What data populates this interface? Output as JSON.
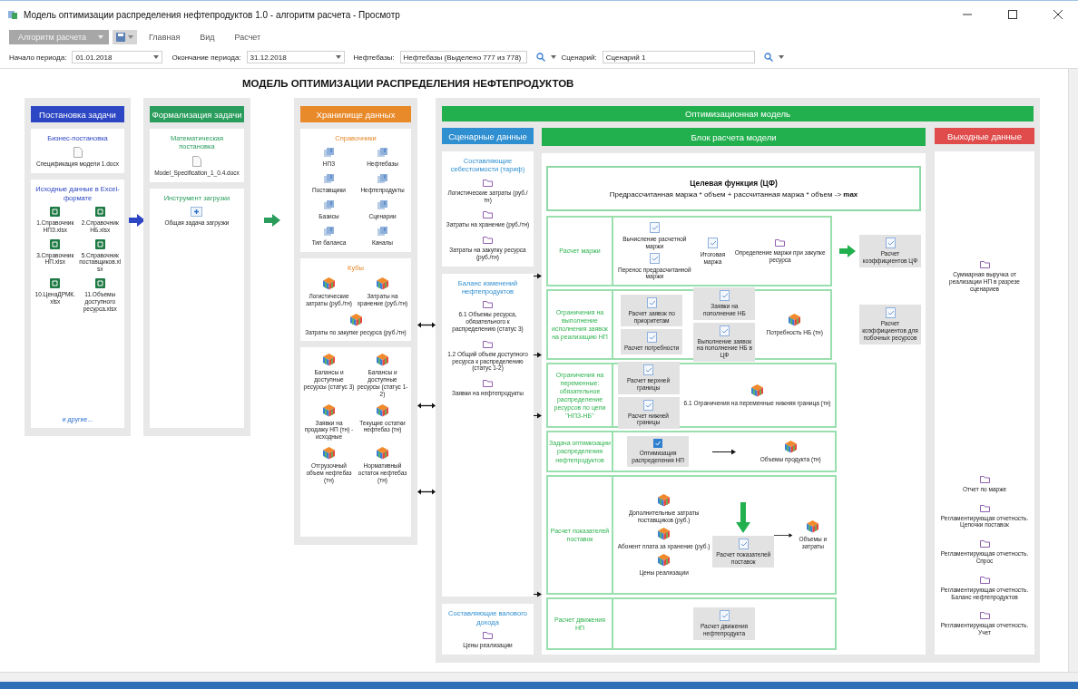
{
  "window": {
    "title": "Модель оптимизации распределения нефтепродуктов 1.0 - алгоритм расчета - Просмотр"
  },
  "ribbon": {
    "menu_button": "Алгоритм расчета",
    "tabs": [
      "Главная",
      "Вид",
      "Расчет"
    ]
  },
  "filters": [
    {
      "label": "Начало периода:",
      "value": "01.01.2018",
      "kind": "date"
    },
    {
      "label": "Окончание периода:",
      "value": "31.12.2018",
      "kind": "date"
    },
    {
      "label": "Нефтебазы:",
      "value": "Нефтебазы (Выделено 777 из 778)",
      "kind": "lookup"
    },
    {
      "label": "Сценарий:",
      "value": "Сценарий 1",
      "kind": "lookup"
    }
  ],
  "diagram": {
    "title": "МОДЕЛЬ ОПТИМИЗАЦИИ РАСПРЕДЕЛЕНИЯ НЕФТЕПРОДУКТОВ",
    "columns": [
      {
        "header": "Постановка задачи",
        "color": "#2d46c3",
        "cards": [
          {
            "title": "Бизнес-постановка",
            "items": [
              {
                "kind": "doc",
                "label": "Спецификация модели 1.docx"
              }
            ]
          },
          {
            "title": "Исходные данные в Excel-формате",
            "link": "и другие...",
            "items": [
              {
                "kind": "excel",
                "label": "1.Справочник НПЗ.xlsx"
              },
              {
                "kind": "excel",
                "label": "2.Справочник НБ.xlsx"
              },
              {
                "kind": "excel",
                "label": "3.Справочник НП.xlsx"
              },
              {
                "kind": "excel",
                "label": "5.Справочник поставщиков.xlsx"
              },
              {
                "kind": "excel",
                "label": "10.ЦенаДРМК.xlsx"
              },
              {
                "kind": "excel",
                "label": "11.Объемы доступного ресурса.xlsx"
              }
            ]
          }
        ]
      },
      {
        "header": "Формализация задачи",
        "color": "#2a9d5c",
        "cards": [
          {
            "title": "Математическая постановка",
            "items": [
              {
                "kind": "doc",
                "label": "Model_Specification_1_0.4.docx"
              }
            ]
          },
          {
            "title": "Инструмент загрузки",
            "items": [
              {
                "kind": "upload",
                "label": "Общая задача загрузки"
              }
            ]
          }
        ]
      },
      {
        "header": "Хранилище данных",
        "color": "#e8892a",
        "cards": [
          {
            "title": "Справочники",
            "items": [
              {
                "kind": "db",
                "label": "НПЗ"
              },
              {
                "kind": "db",
                "label": "Нефтебазы"
              },
              {
                "kind": "db",
                "label": "Поставщики"
              },
              {
                "kind": "db",
                "label": "Нефтепродукты"
              },
              {
                "kind": "db",
                "label": "Базисы"
              },
              {
                "kind": "db",
                "label": "Сценарии"
              },
              {
                "kind": "db",
                "label": "Тип баланса"
              },
              {
                "kind": "db",
                "label": "Каналы"
              }
            ]
          },
          {
            "title": "Кубы",
            "items": [
              {
                "kind": "cube",
                "label": "Логистические затраты (руб./тн)"
              },
              {
                "kind": "cube",
                "label": "Затраты на хранение (руб./тн)"
              },
              {
                "kind": "cube",
                "label": "Затраты по закупке ресурса (руб./тн)"
              }
            ]
          },
          {
            "items": [
              {
                "kind": "cube",
                "label": "Балансы и доступные ресурсы (статус 3)"
              },
              {
                "kind": "cube",
                "label": "Балансы и доступные ресурсы (статус 1-2)"
              },
              {
                "kind": "cube",
                "label": "Заявки на продажу НП (тн) - исходные"
              },
              {
                "kind": "cube",
                "label": "Текущие остатки нефтебаз (тн)"
              },
              {
                "kind": "cube",
                "label": "Отгрузочный объем нефтебаз (тн)"
              },
              {
                "kind": "cube",
                "label": "Нормативный остаток нефтебаз (тн)"
              }
            ]
          }
        ]
      }
    ],
    "model": {
      "header": "Оптимизационная модель",
      "color": "#22b04f",
      "scenario": {
        "header": "Сценарные данные",
        "color": "#2f8fd0",
        "cards": [
          {
            "title": "Составляющие себестоимости (тариф)",
            "items": [
              {
                "kind": "folder",
                "label": "Логистические затраты (руб./тн)"
              },
              {
                "kind": "folder",
                "label": "Затраты на хранение (руб./тн)"
              },
              {
                "kind": "folder",
                "label": "Затраты на закупку ресурса (руб./тн)"
              }
            ]
          },
          {
            "title": "Баланс изменений нефтепродуктов",
            "items": [
              {
                "kind": "folder",
                "label": "6.1 Объемы ресурса, обязательного к распределению (статус 3)"
              },
              {
                "kind": "folder",
                "label": "1.2 Общий объем доступного ресурса к распределению (статус 1-2)"
              },
              {
                "kind": "folder",
                "label": "Заявки на нефтепродукты"
              }
            ]
          },
          {
            "title": "Составляющие валового дохода",
            "items": [
              {
                "kind": "folder",
                "label": "Цены реализации"
              }
            ]
          }
        ]
      },
      "calc": {
        "header": "Блок расчета модели",
        "objective": {
          "title": "Целевая функция (ЦФ)",
          "formula": "Предрассчитанная маржа * объем + рассчитанная маржа * объем -> **max**"
        },
        "rows": [
          {
            "label": "Расчет маржи",
            "groups": [
              {
                "kind": "stack",
                "items": [
                  {
                    "kind": "form",
                    "label": "Вычисление расчетной маржи",
                    "shaded": false
                  },
                  {
                    "kind": "form",
                    "label": "Перенос предрасчитанной маржи",
                    "shaded": false
                  }
                ]
              },
              {
                "kind": "stack",
                "items": [
                  {
                    "kind": "form",
                    "label": "Итоговая маржа",
                    "shaded": false
                  }
                ]
              },
              {
                "kind": "stack",
                "items": [
                  {
                    "kind": "folder",
                    "label": "Определение маржи при закупке ресурса",
                    "shaded": false
                  }
                ]
              }
            ],
            "side": {
              "arrow": true,
              "item": {
                "kind": "form",
                "label": "Расчет коэффициентов ЦФ",
                "shaded": true
              }
            }
          },
          {
            "label": "Ограничения на выполнение исполнения заявок на реализацию НП",
            "groups": [
              {
                "kind": "stack",
                "items": [
                  {
                    "kind": "form",
                    "label": "Расчет заявок по приоритетам",
                    "shaded": true
                  },
                  {
                    "kind": "form",
                    "label": "Расчет потребности",
                    "shaded": true
                  }
                ]
              },
              {
                "kind": "stack",
                "items": [
                  {
                    "kind": "form",
                    "label": "Заявки на пополнение НБ",
                    "shaded": true
                  },
                  {
                    "kind": "form",
                    "label": "Выполнение заявок на пополнение НБ в ЦФ",
                    "shaded": true
                  }
                ]
              },
              {
                "kind": "stack",
                "items": [
                  {
                    "kind": "cube",
                    "label": "Потребность НБ (тн)",
                    "shaded": false
                  }
                ]
              }
            ],
            "side": {
              "arrow": false,
              "item": {
                "kind": "form",
                "label": "Расчет коэффициентов для побочных ресурсов",
                "shaded": true
              }
            }
          },
          {
            "label": "Ограничения на переменные: обязательное распределение ресурсов по цепи \"НПЗ-НБ\"",
            "groups": [
              {
                "kind": "stack",
                "items": [
                  {
                    "kind": "form",
                    "label": "Расчет верхней границы",
                    "shaded": true
                  },
                  {
                    "kind": "form",
                    "label": "Расчет нижней границы",
                    "shaded": true
                  }
                ]
              },
              {
                "kind": "stack",
                "items": [
                  {
                    "kind": "cube",
                    "label": "6.1 Ограничения на переменные нижняя граница (тн)",
                    "shaded": false
                  }
                ]
              }
            ]
          },
          {
            "label": "Задача оптимизации распределения нефтепродуктов",
            "groups": [
              {
                "kind": "stack",
                "items": [
                  {
                    "kind": "opt",
                    "label": "Оптимизация распределения НП",
                    "shaded": true
                  }
                ]
              },
              {
                "kind": "arrow"
              },
              {
                "kind": "stack",
                "items": [
                  {
                    "kind": "cube",
                    "label": "Объемы продукта (тн)",
                    "shaded": false
                  }
                ]
              }
            ]
          },
          {
            "label": "Расчет показателей поставок",
            "groups": [
              {
                "kind": "stack",
                "items": [
                  {
                    "kind": "cube",
                    "label": "Дополнительные затраты поставщиков (руб.)",
                    "shaded": false
                  },
                  {
                    "kind": "cube",
                    "label": "Абонент плата за хранение (руб.)",
                    "shaded": false
                  },
                  {
                    "kind": "cube",
                    "label": "Цены реализации",
                    "shaded": false
                  }
                ]
              },
              {
                "kind": "drop",
                "items": [
                  {
                    "kind": "form",
                    "label": "Расчет показателей поставок",
                    "shaded": true
                  }
                ]
              },
              {
                "kind": "arrow"
              },
              {
                "kind": "stack",
                "items": [
                  {
                    "kind": "cube",
                    "label": "Объемы и затраты",
                    "shaded": false
                  }
                ]
              }
            ]
          },
          {
            "label": "Расчет движения НП",
            "groups": [
              {
                "kind": "stack",
                "items": [
                  {
                    "kind": "form",
                    "label": "Расчет движения нефтепродукта",
                    "shaded": true
                  }
                ]
              }
            ]
          }
        ]
      },
      "output": {
        "header": "Выходные данные",
        "color": "#e04b4b",
        "items": [
          {
            "kind": "folder",
            "label": "Суммарная выручка от реализации НП в разрезе сценариев"
          },
          {
            "kind": "folder",
            "label": "Отчет по марже"
          },
          {
            "kind": "folder",
            "label": "Регламентирующая отчетность. Цепочки поставок"
          },
          {
            "kind": "folder",
            "label": "Регламентирующая отчетность. Спрос"
          },
          {
            "kind": "folder",
            "label": "Регламентирующая отчетность. Баланс нефтепродуктов"
          },
          {
            "kind": "folder",
            "label": "Регламентирующая отчетность. Учет"
          }
        ]
      }
    }
  }
}
